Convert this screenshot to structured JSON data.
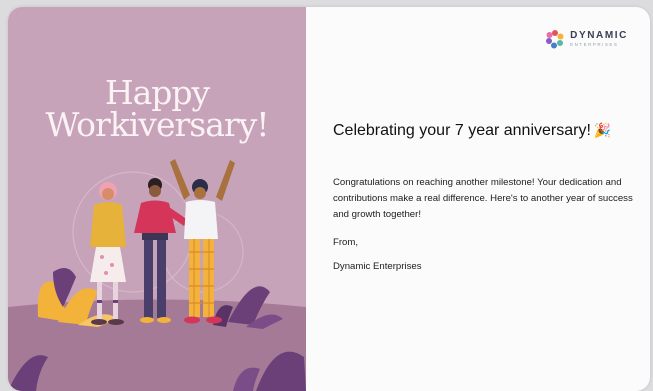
{
  "card": {
    "headline_line1": "Happy",
    "headline_line2": "Workiversary!",
    "company": {
      "name": "DYNAMIC",
      "tagline": "ENTERPRISES"
    },
    "title": "Celebrating your 7 year anniversary!",
    "title_icon": "party-popper-icon",
    "message": "Congratulations on reaching another milestone! Your dedication and contributions make a real difference. Here's to another year of success and growth together!",
    "from_label": "From,",
    "signature": "Dynamic Enterprises"
  },
  "colors": {
    "panel_bg": "#c7a3b9",
    "ground": "#a47a96",
    "headline": "#fbf2f4",
    "leaf_orange": "#f3b23a",
    "leaf_purple": "#6b3f78"
  }
}
